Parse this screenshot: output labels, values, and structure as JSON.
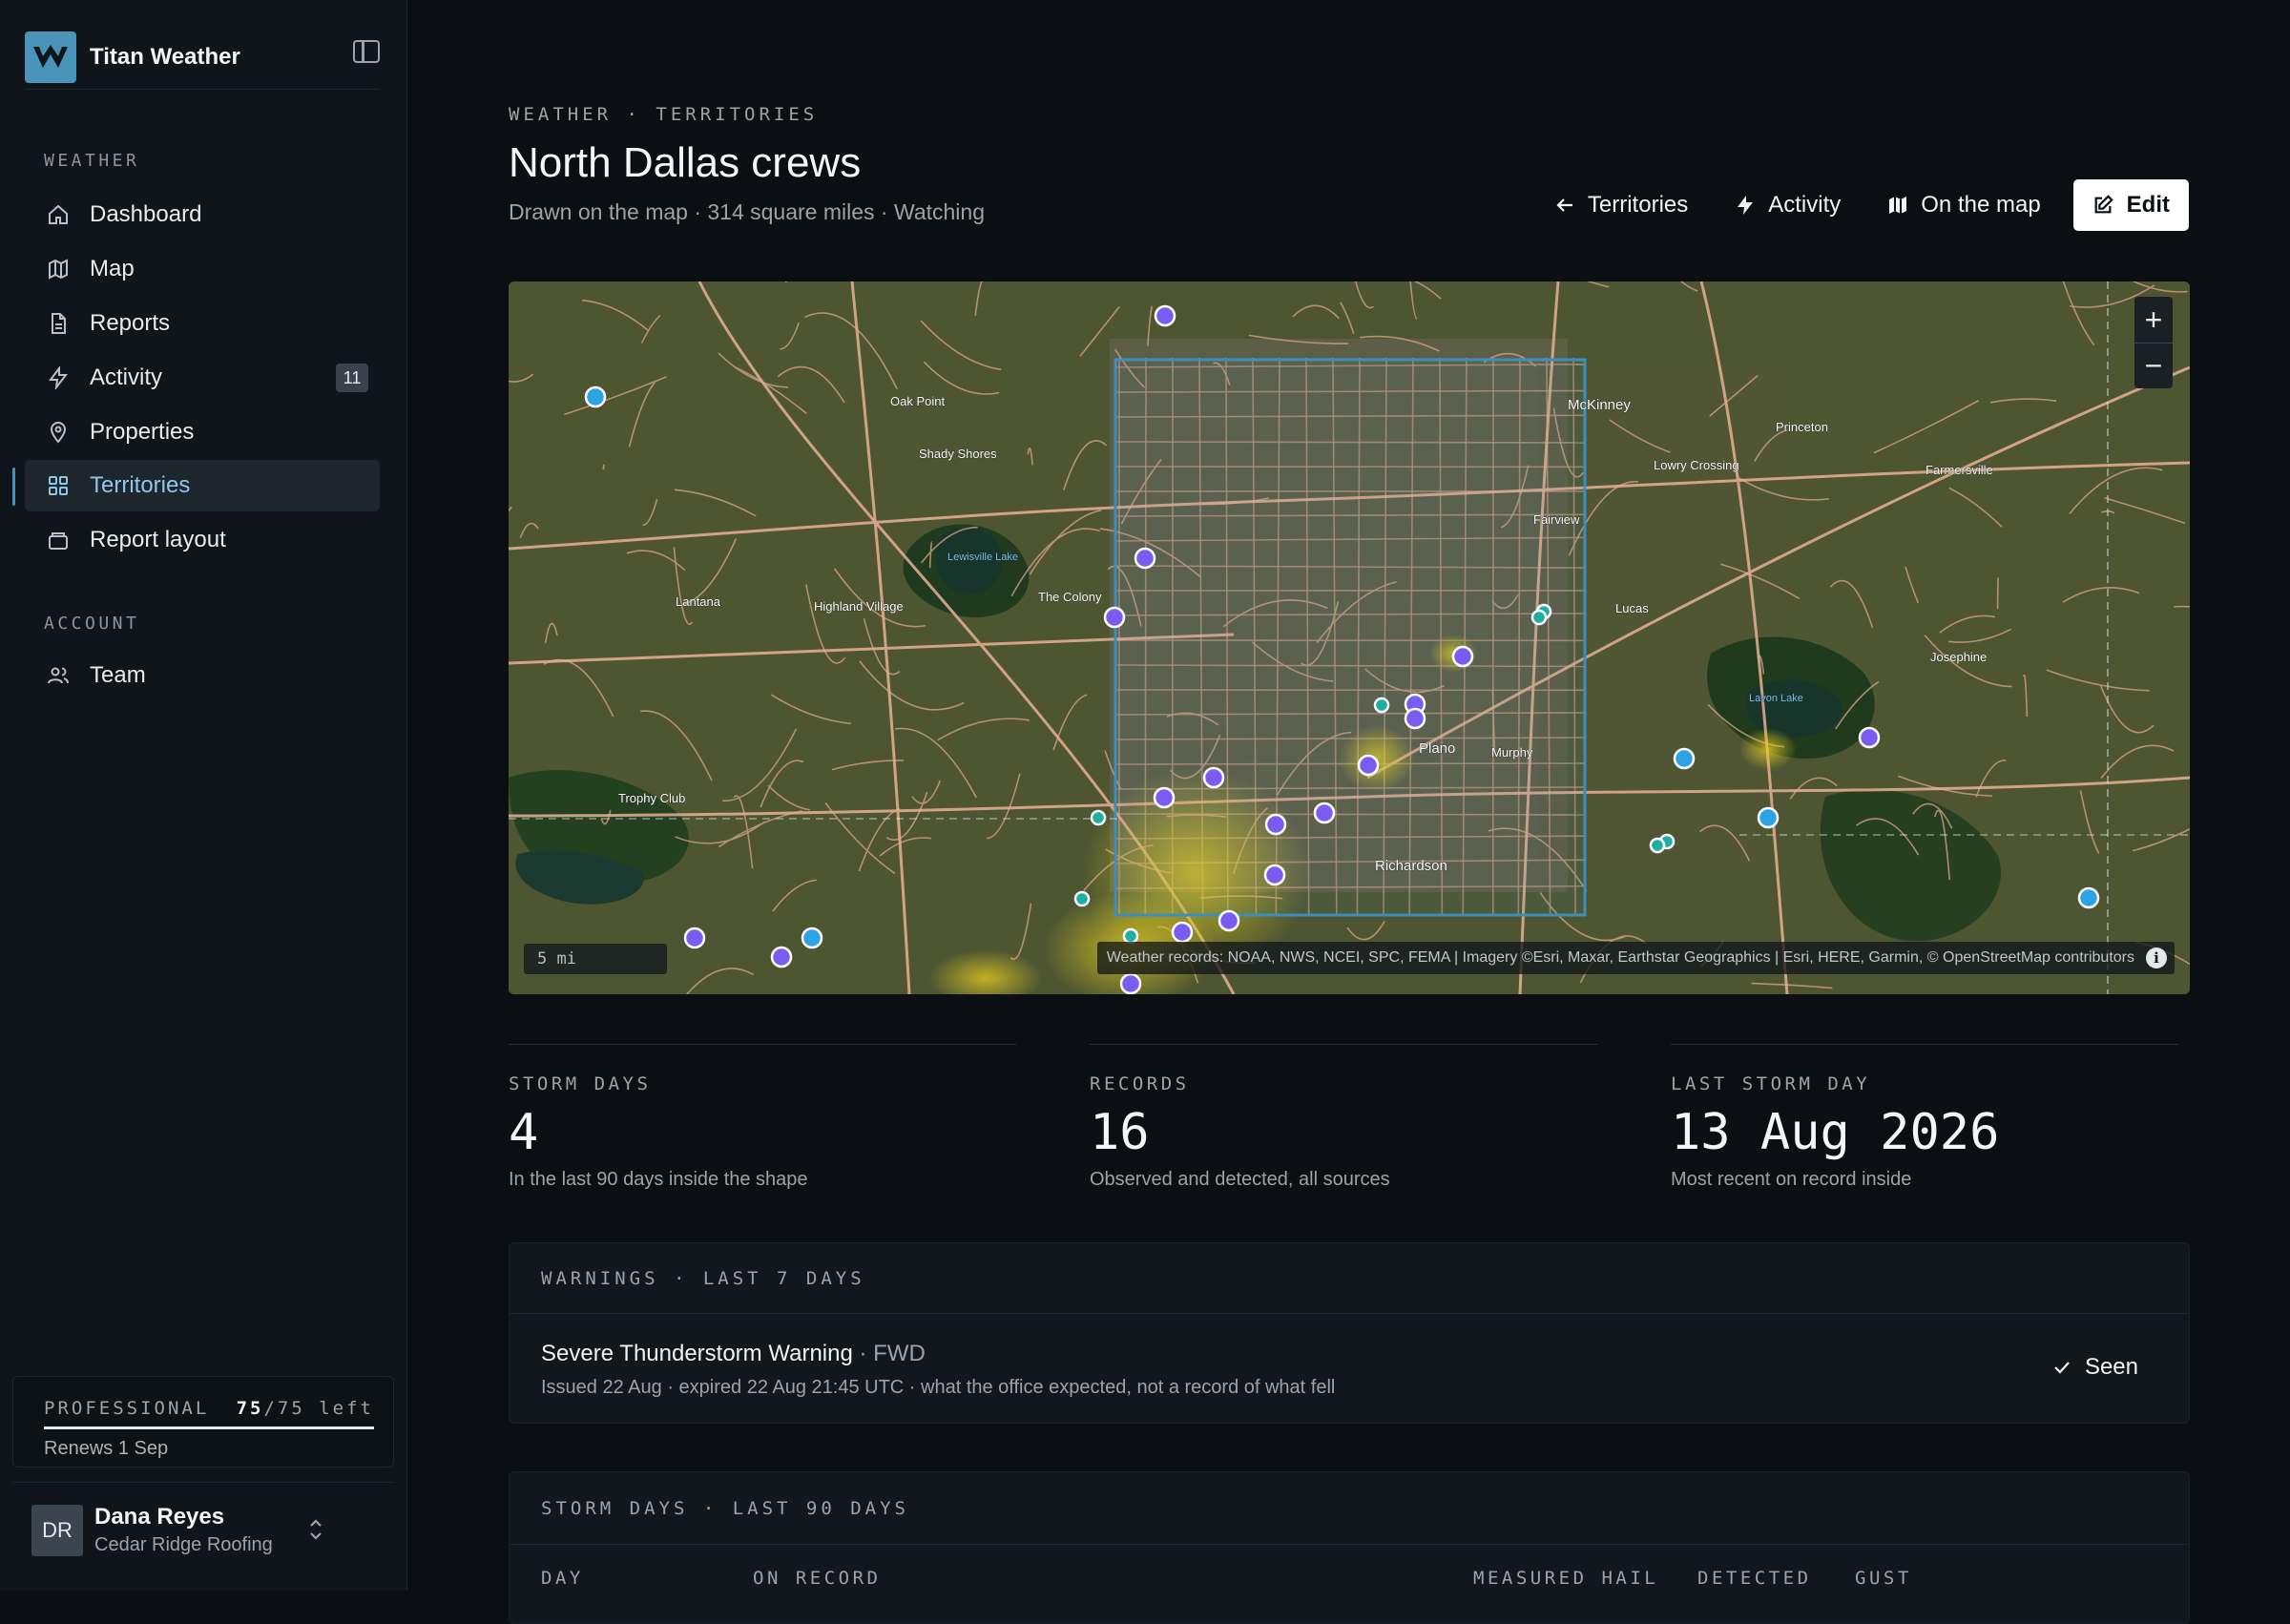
{
  "app": {
    "name": "Titan Weather"
  },
  "sidebar": {
    "section_weather": "WEATHER",
    "items": [
      {
        "label": "Dashboard",
        "icon": "home-icon"
      },
      {
        "label": "Map",
        "icon": "map-icon"
      },
      {
        "label": "Reports",
        "icon": "document-icon"
      },
      {
        "label": "Activity",
        "icon": "bolt-icon",
        "badge": "11"
      },
      {
        "label": "Properties",
        "icon": "pin-icon"
      },
      {
        "label": "Territories",
        "icon": "grid-icon",
        "active": true
      },
      {
        "label": "Report layout",
        "icon": "layout-icon"
      }
    ],
    "section_account": "ACCOUNT",
    "account_items": [
      {
        "label": "Team",
        "icon": "team-icon"
      }
    ],
    "plan": {
      "name": "PROFESSIONAL",
      "used": "75",
      "total": "/75 left",
      "remaining_fraction": 1.0,
      "renews": "Renews 1 Sep"
    },
    "user": {
      "initials": "DR",
      "name": "Dana Reyes",
      "org": "Cedar Ridge Roofing"
    }
  },
  "header": {
    "eyebrow": "WEATHER · TERRITORIES",
    "title": "North Dallas crews",
    "subtitle": "Drawn on the map · 314 square miles · Watching",
    "actions": {
      "territories": "Territories",
      "activity": "Activity",
      "on_map": "On the map",
      "edit": "Edit"
    }
  },
  "map": {
    "scale": "5 mi",
    "attribution": "Weather records: NOAA, NWS, NCEI, SPC, FEMA | Imagery ©Esri, Maxar, Earthstar Geographics | Esri, HERE, Garmin, © OpenStreetMap contributors",
    "zoom_in": "+",
    "zoom_out": "−",
    "labels": {
      "lewisville_lake": "Lewisville Lake",
      "lavon_lake": "Lavon Lake",
      "oak_point": "Oak Point",
      "shady_shores": "Shady Shores",
      "the_colony": "The Colony",
      "highland_village": "Highland Village",
      "lantana": "Lantana",
      "mckinney": "McKinney",
      "princeton": "Princeton",
      "fairview": "Fairview",
      "lucas": "Lucas",
      "plano": "Plano",
      "richardson": "Richardson",
      "josephine": "Josephine",
      "trophy_club": "Trophy Club",
      "murphy": "Murphy",
      "lowry_crossing": "Lowry Crossing",
      "farmersville": "Farmersville"
    },
    "colors": {
      "territory": "#3a8fbf",
      "purple_marker": "#7b5cf0",
      "blue_marker": "#2ba4e6",
      "teal_marker": "#1bb0a0",
      "hail_swath": "#e8d021"
    }
  },
  "stats": [
    {
      "label": "STORM DAYS",
      "value": "4",
      "note": "In the last 90 days inside the shape"
    },
    {
      "label": "RECORDS",
      "value": "16",
      "note": "Observed and detected, all sources"
    },
    {
      "label": "LAST STORM DAY",
      "value": "13 Aug 2026",
      "note": "Most recent on record inside"
    }
  ],
  "warnings": {
    "heading": "WARNINGS · LAST 7 DAYS",
    "items": [
      {
        "title": "Severe Thunderstorm Warning",
        "office": " · FWD",
        "detail": "Issued 22 Aug · expired 22 Aug 21:45 UTC · what the office expected, not a record of what fell",
        "status": "Seen"
      }
    ]
  },
  "storm_days": {
    "heading": "STORM DAYS · LAST 90 DAYS",
    "columns": [
      "DAY",
      "ON RECORD",
      "MEASURED HAIL",
      "DETECTED",
      "GUST"
    ]
  }
}
